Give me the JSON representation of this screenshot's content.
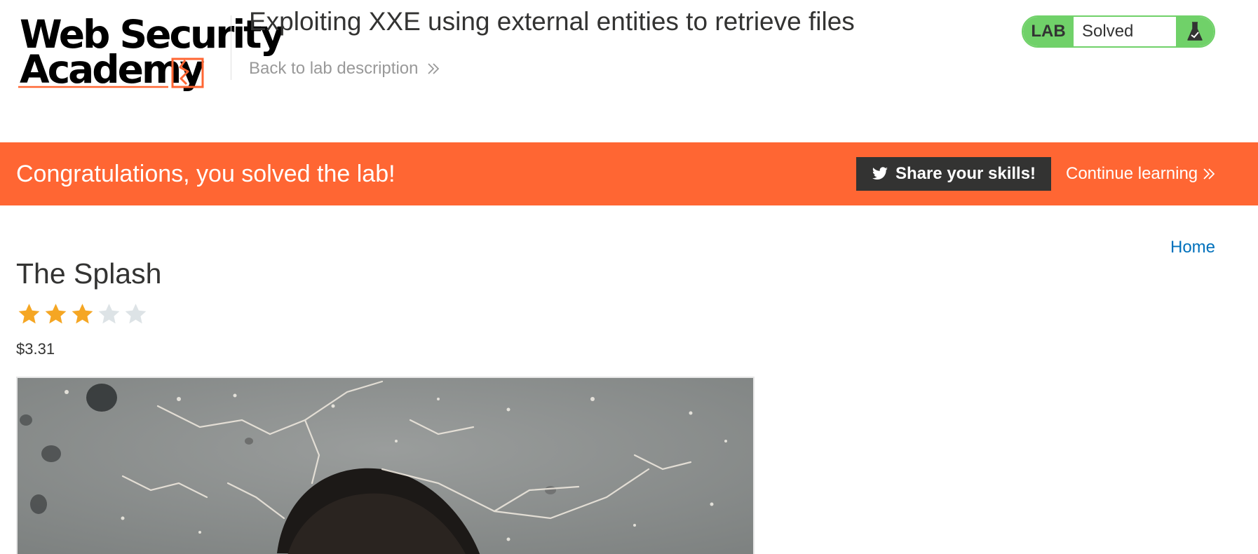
{
  "header": {
    "logo": {
      "line1": "Web Security",
      "line2": "Academy",
      "accent_color": "#ff6633"
    },
    "lab_title": "Exploiting XXE using external entities to retrieve files",
    "back_link": "Back to lab description",
    "lab_badge": {
      "label": "LAB",
      "status": "Solved",
      "icon": "flask-check-icon",
      "color": "#70d169"
    }
  },
  "banner": {
    "message": "Congratulations, you solved the lab!",
    "share_button": "Share your skills!",
    "share_icon": "twitter-icon",
    "continue_link": "Continue learning",
    "background": "#ff6633"
  },
  "nav": {
    "home": "Home"
  },
  "product": {
    "title": "The Splash",
    "rating": 3,
    "rating_max": 5,
    "price": "$3.31",
    "image_icon": "product-photo"
  }
}
